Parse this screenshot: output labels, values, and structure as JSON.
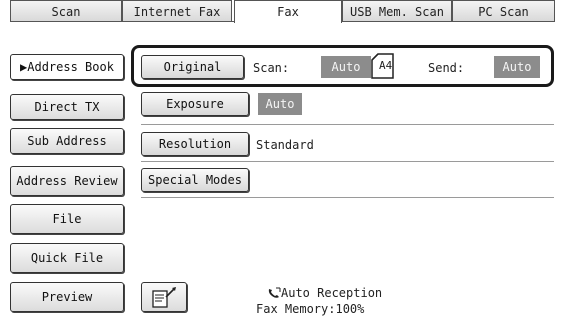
{
  "tabs": [
    {
      "label": "Scan",
      "active": false
    },
    {
      "label": "Internet Fax",
      "active": false
    },
    {
      "label": "Fax",
      "active": true
    },
    {
      "label": "USB Mem. Scan",
      "active": false
    },
    {
      "label": "PC Scan",
      "active": false
    }
  ],
  "sidebar": {
    "address_book": "▶Address Book",
    "direct_tx": "Direct TX",
    "sub_address": "Sub Address",
    "address_review": "Address Review",
    "file": "File",
    "quick_file": "Quick File",
    "preview": "Preview"
  },
  "original": {
    "button": "Original",
    "scan_label": "Scan:",
    "scan_value": "Auto",
    "paper_size": "A4",
    "send_label": "Send:",
    "send_value": "Auto"
  },
  "exposure": {
    "button": "Exposure",
    "value": "Auto"
  },
  "resolution": {
    "button": "Resolution",
    "value": "Standard"
  },
  "special_modes": {
    "button": "Special Modes"
  },
  "status": {
    "reception": "Auto Reception",
    "memory": "Fax Memory:100%"
  },
  "colors": {
    "highlight_border": "#1a1a1a",
    "value_bg": "#8c8c8c"
  }
}
